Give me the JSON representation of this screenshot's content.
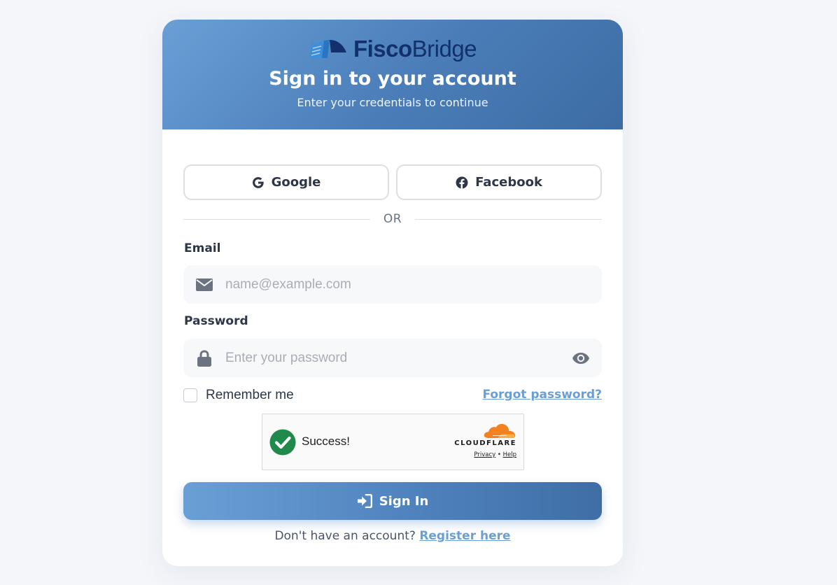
{
  "brand": {
    "name_strong": "Fisco",
    "name_light": "Bridge",
    "logo_color": "#12306b",
    "logo_accent": "#3f8fd8"
  },
  "header": {
    "title": "Sign in to your account",
    "subtitle": "Enter your credentials to continue",
    "gradient_start": "#6a9fd6",
    "gradient_end": "#3d6ca3"
  },
  "social": {
    "google_label": "Google",
    "facebook_label": "Facebook"
  },
  "divider": {
    "text": "OR"
  },
  "form": {
    "email_label": "Email",
    "email_value": "",
    "email_placeholder": "name@example.com",
    "password_label": "Password",
    "password_value": "",
    "password_placeholder": "Enter your password",
    "remember_label": "Remember me",
    "remember_checked": false,
    "forgot_label": "Forgot password?"
  },
  "captcha": {
    "status": "Success!",
    "provider": "CLOUDFLARE",
    "privacy_label": "Privacy",
    "separator": "•",
    "help_label": "Help",
    "check_color": "#1f8a4c",
    "cloud_color": "#f48120"
  },
  "actions": {
    "signin_label": "Sign In"
  },
  "footer": {
    "prompt": "Don't have an account?",
    "register_label": "Register here"
  },
  "colors": {
    "accent": "#6a9fd6",
    "text": "#2d3748",
    "muted": "#6b7280",
    "background": "#f5f6fa"
  }
}
